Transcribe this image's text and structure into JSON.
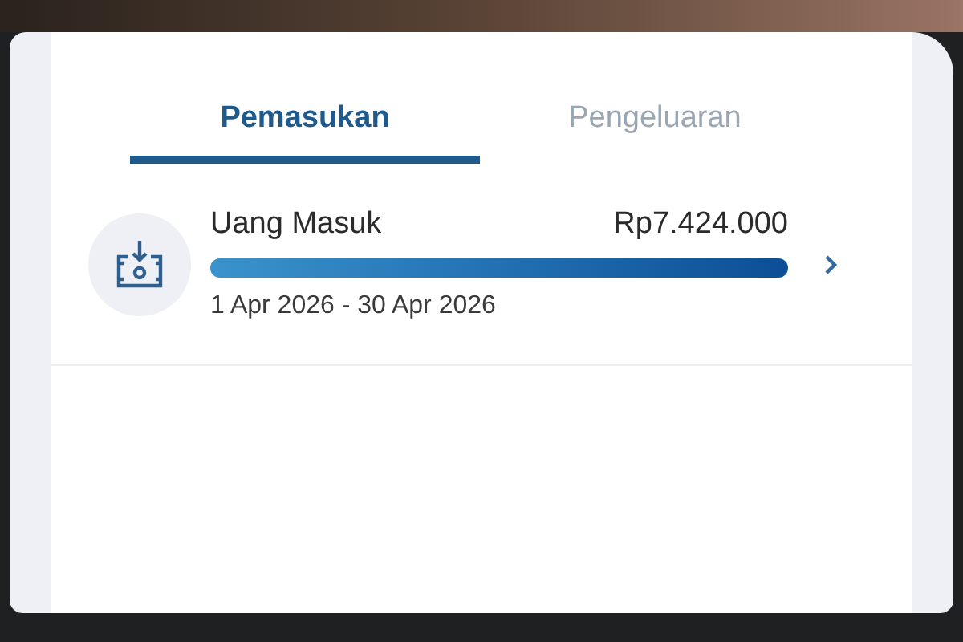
{
  "tabs": [
    {
      "label": "Pemasukan",
      "selected": true
    },
    {
      "label": "Pengeluaran",
      "selected": false
    }
  ],
  "items": [
    {
      "title": "Uang Masuk",
      "amount": "Rp7.424.000",
      "level": 1,
      "period": "1 Apr 2026 - 30 Apr 2026"
    }
  ]
}
